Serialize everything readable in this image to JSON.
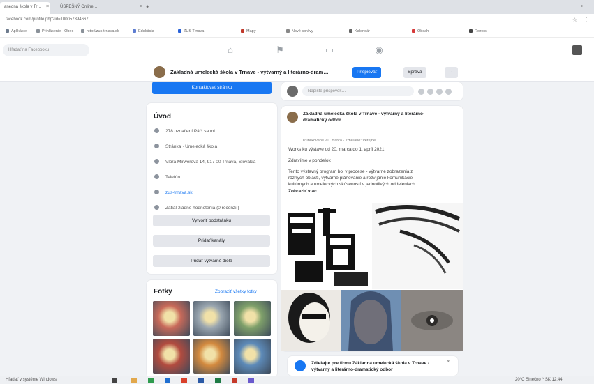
{
  "browser": {
    "tabs": [
      "anedná škola v Tr…",
      "ÚSPEŠNÝ Online…"
    ],
    "url": "facebook.com/profile.php?id=100057394667"
  },
  "bookmarks": [
    {
      "label": "Aplikácie",
      "color": "#6d7b8d"
    },
    {
      "label": "Prihlásenie - Obec",
      "color": "#8a9199"
    },
    {
      "label": "http://zus-trnava.sk",
      "color": "#8a9199"
    },
    {
      "label": "Edukácia",
      "color": "#5d7dd1"
    },
    {
      "label": "ZUŠ Trnava",
      "color": "#2962d9"
    },
    {
      "label": "Mapy",
      "color": "#c0392b"
    },
    {
      "label": "Nové správy",
      "color": "#888"
    },
    {
      "label": "Kalendár",
      "color": "#666"
    },
    {
      "label": "Obsah",
      "color": "#d63a3a"
    },
    {
      "label": "Rozpis",
      "color": "#444"
    }
  ],
  "fb": {
    "search_placeholder": "Hľadať na Facebooku",
    "page_name": "Základná umelecká škola v Trnave - výtvarný a literárno-dram…",
    "btn_following": "Prispievať",
    "btn_message": "Správa",
    "btn_more": "···"
  },
  "left": {
    "blue_button": "Kontaktovať stránku",
    "about_title": "Úvod",
    "about": [
      {
        "icon": "likes-icon",
        "text": "278 označení Páči sa mi",
        "link": false
      },
      {
        "icon": "page-icon",
        "text": "Stránka · Umelecká škola",
        "link": false
      },
      {
        "icon": "location-icon",
        "text": "Vlora Mirwerova 14, 917 00 Trnava, Slovakia",
        "link": false
      },
      {
        "icon": "phone-icon",
        "text": "Telefón",
        "link": false
      },
      {
        "icon": "web-icon",
        "text": "zus-trnava.sk",
        "link": true
      },
      {
        "icon": "info-icon",
        "text": "Zatiaľ žiadne hodnotenia (0 recenzií)",
        "link": false
      }
    ],
    "buttons": [
      "Vytvoriť podstránku",
      "Pridať kanály",
      "Pridať výtvarné diela"
    ],
    "photos_title": "Fotky",
    "photos_link": "Zobraziť všetky fotky",
    "thumb_colors": [
      "#c86a5a",
      "#9aa6b0",
      "#7fa06a",
      "#b24b3f",
      "#d38a3f",
      "#5d8ab8"
    ]
  },
  "right": {
    "composer_placeholder": "Napíšte príspevok…",
    "post_author": "Základná umelecká škola v Trnave - výtvarný a literárno-dramatický odbor",
    "post_meta": "Publikované 20. marca · Zdieľané: Verejné",
    "post_lines": [
      "Works ku výstave od 20. marca do 1. apríl 2021",
      "Zdravíme v pondelok",
      "Tento výstavný program bol v procese - výtvarné zobrazenia z",
      "rôznych oblastí, výtvarné plánovanie a rozvíjanie komunikácie",
      "kultúrnych a umeleckých skúseností v jednotlivých oddeleniach",
      "Zobraziť viac"
    ],
    "notice": "Zdieľajte pre firmu Základná umelecká škola v Trnave - výtvarný a literárno-dramatický odbor"
  },
  "taskbar": {
    "left_text": "Hľadať v systéme Windows",
    "right_text": "20°C  Slnečno  ^  SK  12:44"
  },
  "colors": {
    "accent": "#1877f2",
    "background": "#f0f2f5"
  }
}
